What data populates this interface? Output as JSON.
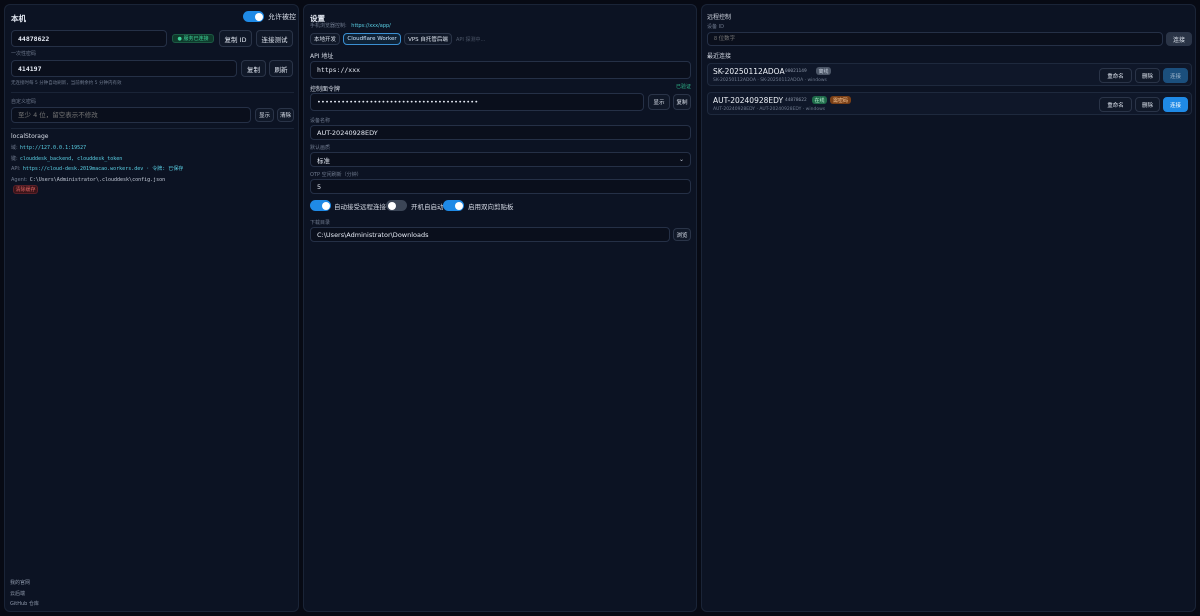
{
  "local": {
    "title": "本机",
    "allow_control_label": "允许被控",
    "device_id": "44878622",
    "service_status": "● 服务已连接",
    "copy_id_label": "复制 ID",
    "test_connection_label": "连接测试",
    "otp_label": "一次性密码",
    "otp_value": "414197",
    "copy_label": "复制",
    "refresh_label": "刷新",
    "otp_hint": "无连接时每 5 分钟自动刷新，当前剩余约 5 分钟内有效",
    "custom_password_label": "自定义密码",
    "custom_password_placeholder": "至少 4 位，留空表示不修改",
    "show_label": "显示",
    "clear_label": "清除",
    "storage_title": "localStorage",
    "storage_lines": [
      {
        "key": "域:",
        "value": "http://127.0.0.1:19527"
      },
      {
        "key": "键:",
        "value": "clouddesk_backend, clouddesk_token"
      },
      {
        "key": "API:",
        "value": "https://cloud-desk.2019macao.workers.dev · 令牌: 已保存"
      },
      {
        "key": "Agent:",
        "value": "C:\\Users\\Administrator\\.clouddesk\\config.json"
      }
    ],
    "danger_label": "清除缓存",
    "footer_links": [
      "我的官网",
      "云后端",
      "GitHub 仓库"
    ]
  },
  "settings": {
    "title": "设置",
    "phone_control_label": "手机浏览器控制:",
    "phone_control_link": "https://xxx/app/",
    "mode_options": [
      "本地开发",
      "Cloudflare Worker",
      "VPS 自托管后端"
    ],
    "selected_mode": "Cloudflare Worker",
    "api_status": "API 探测中...",
    "api_address_label": "API 地址",
    "api_address_value": "https://xxx",
    "token_label": "控制面令牌",
    "token_status": "已验证",
    "token_value": "••••••••••••••••••••••••••••••••••••••••",
    "token_show_label": "显示",
    "token_copy_label": "复制",
    "device_name_label": "设备名称",
    "device_name_value": "AUT-20240928EDY",
    "default_quality_label": "默认画质",
    "default_quality_value": "标准",
    "otp_interval_label": "OTP 空闲刷新（分钟）",
    "otp_interval_value": "5",
    "toggles": [
      {
        "label": "自动接受远程连接",
        "on": true
      },
      {
        "label": "开机自启动",
        "on": false
      },
      {
        "label": "启用双向剪贴板",
        "on": true
      }
    ],
    "download_dir_label": "下载目录",
    "download_dir_value": "C:\\Users\\Administrator\\Downloads",
    "browse_label": "浏览"
  },
  "remote": {
    "title": "远程控制",
    "device_id_label": "设备 ID",
    "device_id_placeholder": "8 位数字",
    "connect_label": "连接",
    "recent_label": "最近连接",
    "recent": [
      {
        "name": "SK-20250112ADOA",
        "id": "00021149",
        "badges": [
          {
            "text": "离线",
            "color": "#4b5566",
            "fg": "#aeb8c8"
          }
        ],
        "sub": "SK-20250112ADOA · SK-20250112ADOA · windows",
        "rename": "重命名",
        "delete": "删除",
        "connect": "连接",
        "online": false
      },
      {
        "name": "AUT-20240928EDY",
        "id": "44878622",
        "badges": [
          {
            "text": "在线",
            "color": "#1f6b4a",
            "fg": "#b8f0d2"
          },
          {
            "text": "需密码",
            "color": "#7a3f16",
            "fg": "#ffcf9e"
          }
        ],
        "sub": "AUT-20240928EDY · AUT-20240928EDY · windows",
        "rename": "重命名",
        "delete": "删除",
        "connect": "连接",
        "online": true
      }
    ]
  },
  "colors": {
    "accent": "#1f8ae6",
    "panel": "#0c1323",
    "background": "#070a14",
    "link": "#5ad1e6",
    "success": "#2fb58a",
    "danger": "#e06464"
  }
}
